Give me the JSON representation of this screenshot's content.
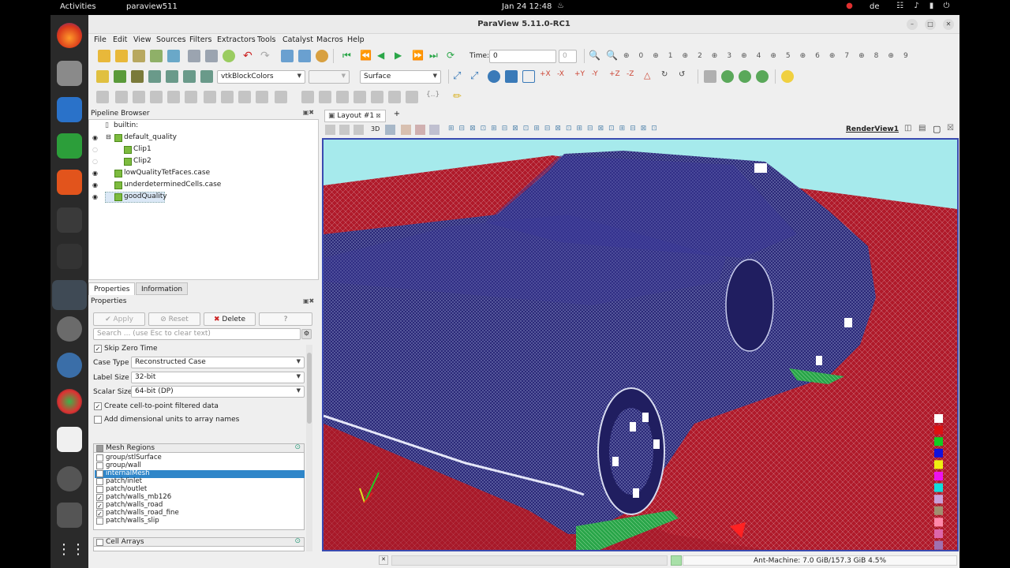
{
  "topbar": {
    "activities": "Activities",
    "app": "paraview511",
    "clock": "Jan 24  12:48",
    "lang": "de"
  },
  "window": {
    "title": "ParaView 5.11.0-RC1"
  },
  "menu": [
    "File",
    "Edit",
    "View",
    "Sources",
    "Filters",
    "Extractors",
    "Tools",
    "Catalyst",
    "Macros",
    "Help"
  ],
  "toolbar": {
    "time_label": "Time:",
    "time_value": "0",
    "time_index": "0",
    "coloring": "vtkBlockColors",
    "representation": "Surface",
    "camera_numbers": [
      "0",
      "1",
      "2",
      "3",
      "4",
      "5",
      "6",
      "7",
      "8",
      "9"
    ]
  },
  "pipeline": {
    "title": "Pipeline Browser",
    "items": [
      {
        "label": "builtin:"
      },
      {
        "label": "default_quality"
      },
      {
        "label": "Clip1"
      },
      {
        "label": "Clip2"
      },
      {
        "label": "lowQualityTetFaces.case"
      },
      {
        "label": "underdeterminedCells.case"
      },
      {
        "label": "goodQuality"
      }
    ]
  },
  "properties": {
    "tabs": [
      "Properties",
      "Information"
    ],
    "title": "Properties",
    "apply": "Apply",
    "reset": "Reset",
    "delete": "Delete",
    "help": "?",
    "search_placeholder": "Search ... (use Esc to clear text)",
    "skip_zero_time": "Skip Zero Time",
    "case_type_label": "Case Type",
    "case_type": "Reconstructed Case",
    "label_size_label": "Label Size",
    "label_size": "32-bit",
    "scalar_size_label": "Scalar Size",
    "scalar_size": "64-bit (DP)",
    "cell_to_point": "Create cell-to-point filtered data",
    "dim_units": "Add dimensional units to array names",
    "mesh_regions_header": "Mesh Regions",
    "mesh_regions": [
      {
        "name": "group/stlSurface",
        "checked": false
      },
      {
        "name": "group/wall",
        "checked": false
      },
      {
        "name": "internalMesh",
        "checked": false,
        "selected": true
      },
      {
        "name": "patch/inlet",
        "checked": false
      },
      {
        "name": "patch/outlet",
        "checked": false
      },
      {
        "name": "patch/walls_mb126",
        "checked": true
      },
      {
        "name": "patch/walls_road",
        "checked": true
      },
      {
        "name": "patch/walls_road_fine",
        "checked": true
      },
      {
        "name": "patch/walls_slip",
        "checked": false
      }
    ],
    "cell_arrays_header": "Cell Arrays"
  },
  "view": {
    "layout_tab": "Layout #1",
    "render_view": "RenderView1",
    "mode_3d": "3D"
  },
  "status": {
    "memory": "Ant-Machine: 7.0 GiB/157.3 GiB 4.5%"
  },
  "colors": {
    "accent": "#3a4ab0",
    "sky": "#a6eaec",
    "ground": "#b01a2a",
    "car": "#2a2878",
    "selection": "#2f86c9"
  },
  "legend_colors": [
    "#ffffff",
    "#dd1111",
    "#11cc22",
    "#1111dd",
    "#eeee11",
    "#ee11ee",
    "#11dddd",
    "#c8a0d8",
    "#a09070",
    "#ff88aa",
    "#dd66aa",
    "#a070b0",
    "#ffb090"
  ]
}
